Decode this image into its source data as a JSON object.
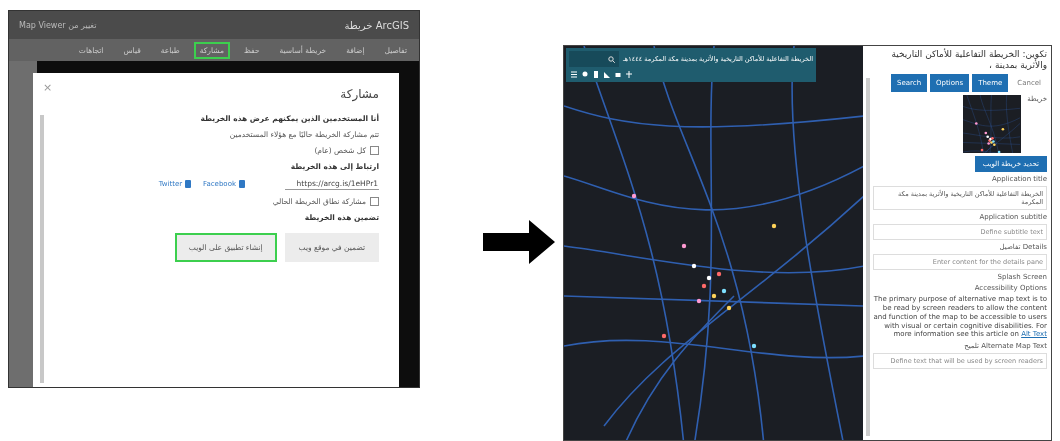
{
  "share_screen": {
    "app_title": "ArcGIS خريطة",
    "header_text": "تغيير من Map Viewer",
    "toolbar": [
      {
        "label": "تفاصيل",
        "highlighted": false
      },
      {
        "label": "إضافة",
        "highlighted": false
      },
      {
        "label": "خريطة أساسية",
        "highlighted": false
      },
      {
        "label": "حفظ",
        "highlighted": false
      },
      {
        "label": "مشاركة",
        "highlighted": true
      },
      {
        "label": "طباعة",
        "highlighted": false
      },
      {
        "label": "قياس",
        "highlighted": false
      },
      {
        "label": "اتجاهات",
        "highlighted": false
      }
    ],
    "dialog": {
      "title": "مشاركة",
      "close": "×",
      "who_label": "أنا المستخدمين الذين يمكنهم عرض هذه الخريطة",
      "shared_with": "تتم مشاركة الخريطة حاليًا مع هؤلاء المستخدمين",
      "everyone": {
        "label": "كل شخص (عام)",
        "checked": false
      },
      "link_label": "ارتباط إلى هذه الخريطة",
      "link_url": "https://arcg.is/1eHPr1",
      "social": [
        {
          "label": "Facebook"
        },
        {
          "label": "Twitter"
        }
      ],
      "share_extent": {
        "label": "مشاركة نطاق الخريطة الحالي",
        "checked": false
      },
      "embed_label": "تضمين هذه الخريطة",
      "embed_buttons": [
        {
          "label": "تضمين في موقع ويب",
          "highlighted": false
        },
        {
          "label": "إنشاء تطبيق على الويب",
          "highlighted": true
        }
      ]
    }
  },
  "config_screen": {
    "map_title": "الخريطة التفاعلية للأماكن التاريخية والأثرية بمدينة مكة المكرمة ١٤٤٤هـ",
    "panel_title": "تكوين: الخريطة التفاعلية للأماكن التاريخية والأثرية بمدينة ،",
    "buttons": [
      {
        "label": "Cancel",
        "kind": "plain"
      },
      {
        "label": "Theme",
        "kind": "primary"
      },
      {
        "label": "Options",
        "kind": "primary"
      },
      {
        "label": "Search",
        "kind": "primary"
      }
    ],
    "map_label": "خريطة",
    "select_map_button": "تحديد خريطة الويب",
    "fields": [
      {
        "label": "Application title",
        "value": "الخريطة التفاعلية للأماكن التاريخية والأثرية بمدينة مكة المكرمة"
      },
      {
        "label": "Application subtitle",
        "placeholder": "Define subtitle text"
      },
      {
        "label": "Details تفاصيل",
        "placeholder": "Enter content for the details pane"
      }
    ],
    "splash": "Splash Screen",
    "accessibility_heading": "Accessibility Options",
    "paragraph": "The primary purpose of alternative map text is to be read by screen readers to allow the content and function of the map to be accessible to users with visual or certain cognitive disabilities. For more information see this article on",
    "paragraph_link": "Alt Text",
    "alt_field": {
      "label": "Alternate Map Text تلميح",
      "placeholder": "Define text that will be used by screen readers"
    }
  }
}
